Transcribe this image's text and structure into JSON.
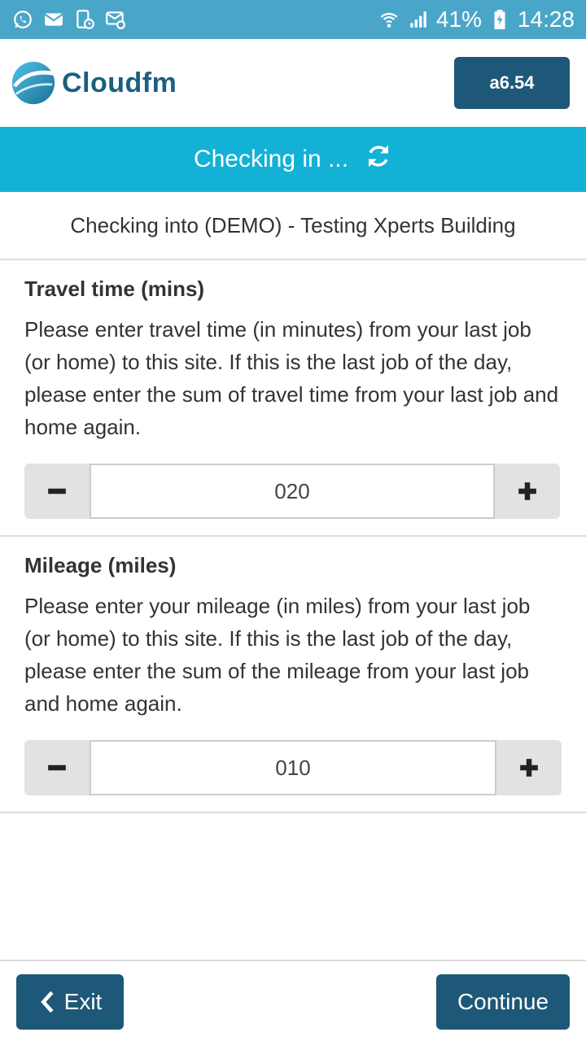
{
  "status_bar": {
    "battery": "41%",
    "time": "14:28",
    "left_icons": [
      "whatsapp-icon",
      "mail-icon",
      "device-clock-icon",
      "mail-settings-icon"
    ],
    "right_icons": [
      "wifi-icon",
      "signal-icon",
      "battery-charging-icon"
    ]
  },
  "header": {
    "brand": "Cloudfm",
    "version_label": "a6.54"
  },
  "banner": {
    "text": "Checking in ...",
    "icon": "refresh-icon"
  },
  "subtitle": "Checking into (DEMO) - Testing Xperts Building",
  "travel": {
    "title": "Travel time (mins)",
    "description": "Please enter travel time (in minutes) from your last job (or home) to this site. If this is the last job of the day, please enter the sum of travel time from your last job and home again.",
    "value": "020"
  },
  "mileage": {
    "title": "Mileage (miles)",
    "description": "Please enter your mileage (in miles) from your last job (or home) to this site. If this is the last job of the day, please enter the sum of the mileage from your last job and home again.",
    "value": "010"
  },
  "footer": {
    "exit_label": "Exit",
    "continue_label": "Continue"
  },
  "colors": {
    "status_bar": "#4aa6c9",
    "banner": "#13b1d6",
    "primary_button": "#1e5878",
    "brand_text": "#1b5f80",
    "stepper_button": "#e2e2e2"
  }
}
